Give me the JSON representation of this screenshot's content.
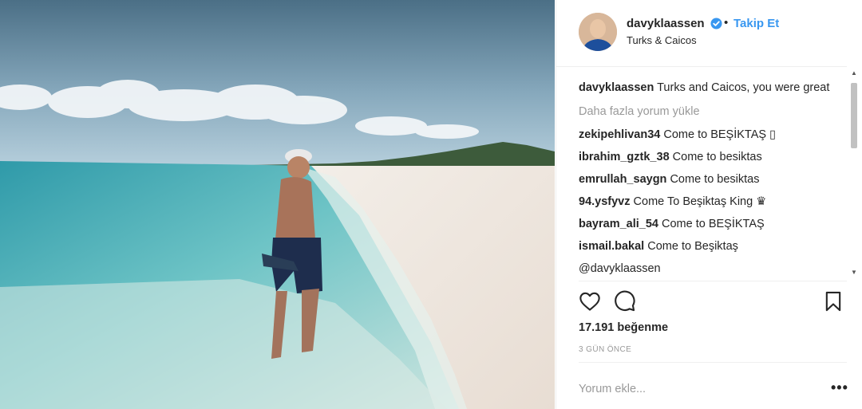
{
  "post": {
    "username": "davyklaassen",
    "separator": "•",
    "follow_label": "Takip Et",
    "location": "Turks & Caicos",
    "caption": {
      "user": "davyklaassen",
      "text": "Turks and Caicos, you were great"
    },
    "load_more_label": "Daha fazla yorum yükle",
    "comments": [
      {
        "user": "zekipehlivan34",
        "text": "Come to BEŞİKTAŞ ▯"
      },
      {
        "user": "ibrahim_gztk_38",
        "text": "Come to besiktas"
      },
      {
        "user": "emrullah_saygn",
        "text": "Come to besiktas"
      },
      {
        "user": "94.ysfyvz",
        "text": "Come To Beşiktaş King ♛"
      },
      {
        "user": "bayram_ali_54",
        "text": "Come to BEŞİKTAŞ"
      },
      {
        "user": "ismail.bakal",
        "text": "Come to Beşiktaş"
      },
      {
        "user": "",
        "text": "@davyklaassen"
      }
    ],
    "likes_label": "17.191 beğenme",
    "time_label": "3 GÜN ÖNCE",
    "comment_placeholder": "Yorum ekle...",
    "more_options_label": "•••"
  },
  "colors": {
    "link_blue": "#3897f0",
    "text": "#262626",
    "muted": "#999999",
    "border": "#efefef"
  },
  "icons": {
    "like": "heart-icon",
    "comment": "speech-bubble-icon",
    "save": "bookmark-icon",
    "verified": "verified-badge-icon"
  }
}
